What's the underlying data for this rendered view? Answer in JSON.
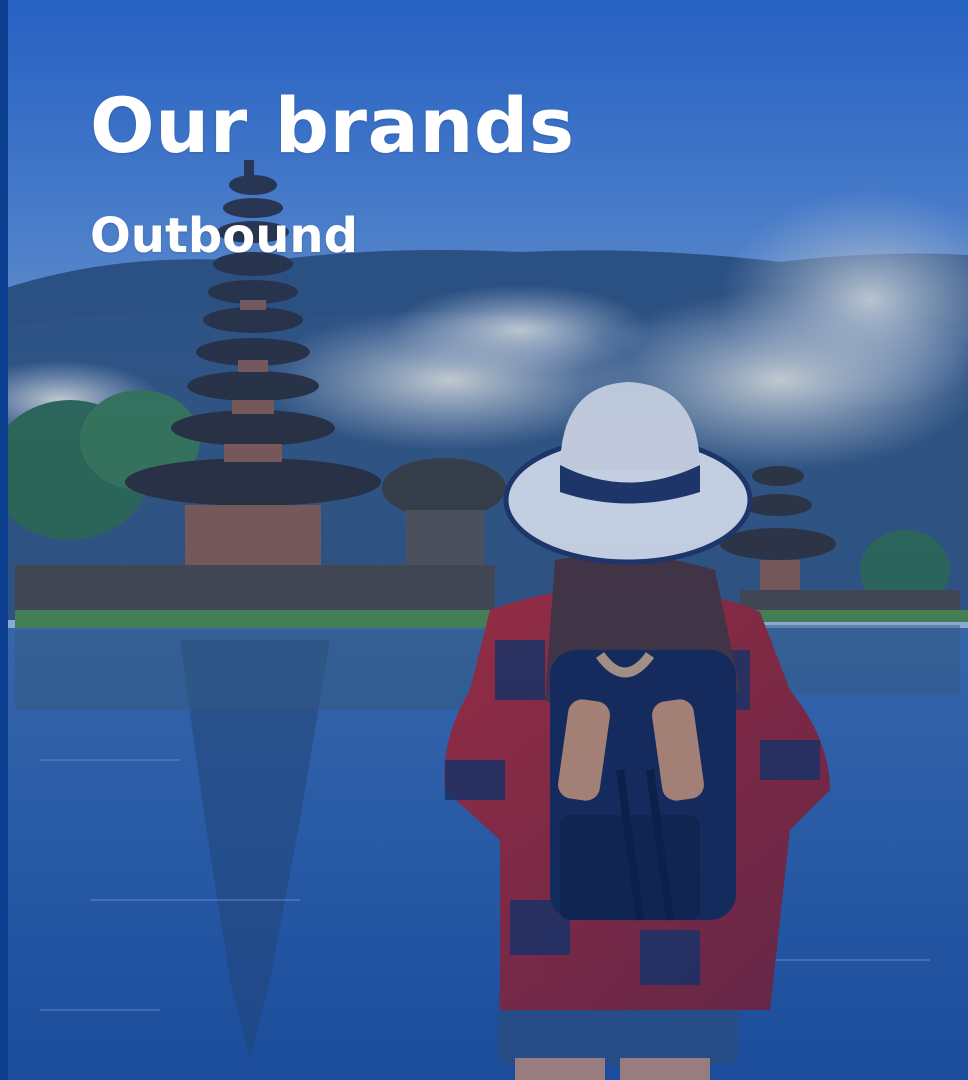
{
  "slide": {
    "title": "Our brands",
    "subtitle": "Outbound"
  },
  "colors": {
    "accent_bar": "#0d3f91",
    "sky_top": "#2a66c4",
    "water": "#1d4f9a"
  },
  "image": {
    "description_icon": "travel-photo-bali-temple-lake"
  }
}
